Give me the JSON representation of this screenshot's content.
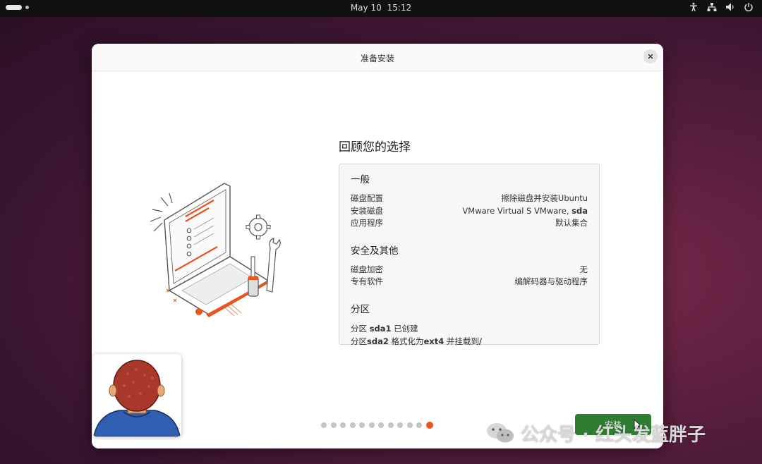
{
  "topbar": {
    "date": "May 10",
    "time": "15:12",
    "icons": [
      "accessibility-icon",
      "network-icon",
      "volume-icon",
      "power-icon"
    ]
  },
  "dialog": {
    "title": "准备安装",
    "heading": "回顾您的选择",
    "sections": [
      {
        "title": "一般",
        "rows": [
          {
            "label": "磁盘配置",
            "value": "擦除磁盘并安装Ubuntu"
          },
          {
            "label": "安装磁盘",
            "value_prefix": "VMware Virtual S VMware, ",
            "value_bold": "sda"
          },
          {
            "label": "应用程序",
            "value": "默认集合"
          }
        ]
      },
      {
        "title": "安全及其他",
        "rows": [
          {
            "label": "磁盘加密",
            "value": "无"
          },
          {
            "label": "专有软件",
            "value": "编解码器与驱动程序"
          }
        ]
      },
      {
        "title": "分区",
        "lines": [
          {
            "prefix": "分区 ",
            "bold": "sda1",
            "suffix": " 已创建"
          },
          {
            "prefix": "分区",
            "bold": "sda2",
            "middle": " 格式化为",
            "bold2": "ext4",
            "middle2": " 并挂载到",
            "bold3": "/"
          }
        ]
      }
    ],
    "install_label": "安装",
    "progress": {
      "total_steps": 12,
      "current_step": 12
    }
  },
  "watermark": {
    "text": "公众号 · 红头发蓝胖子"
  },
  "colors": {
    "accent": "#e95420",
    "install_button": "#2e7d32",
    "topbar": "#111111"
  }
}
